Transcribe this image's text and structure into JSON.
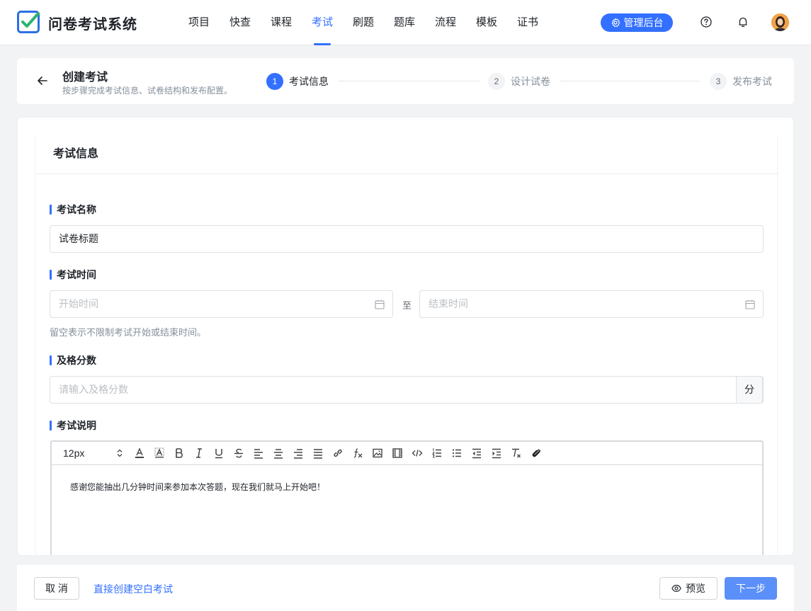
{
  "app": {
    "title": "问卷考试系统"
  },
  "nav": {
    "items": [
      {
        "label": "项目"
      },
      {
        "label": "快查"
      },
      {
        "label": "课程"
      },
      {
        "label": "考试",
        "active": true
      },
      {
        "label": "刷题"
      },
      {
        "label": "题库"
      },
      {
        "label": "流程"
      },
      {
        "label": "模板"
      },
      {
        "label": "证书"
      }
    ],
    "admin_label": "管理后台"
  },
  "header": {
    "title": "创建考试",
    "subtitle": "按步骤完成考试信息、试卷结构和发布配置。",
    "steps": [
      {
        "num": "1",
        "label": "考试信息"
      },
      {
        "num": "2",
        "label": "设计试卷"
      },
      {
        "num": "3",
        "label": "发布考试"
      }
    ]
  },
  "form": {
    "section_title": "考试信息",
    "name": {
      "label": "考试名称",
      "value": "试卷标题"
    },
    "time": {
      "label": "考试时间",
      "start_placeholder": "开始时间",
      "separator": "至",
      "end_placeholder": "结束时间",
      "hint": "留空表示不限制考试开始或结束时间。"
    },
    "pass_score": {
      "label": "及格分数",
      "placeholder": "请输入及格分数",
      "suffix": "分"
    },
    "description": {
      "label": "考试说明",
      "font_size": "12px",
      "content": "感谢您能抽出几分钟时间来参加本次答题，现在我们就马上开始吧！"
    }
  },
  "footer": {
    "cancel_label": "取 消",
    "blank_link": "直接创建空白考试",
    "preview_label": "预览",
    "next_label": "下一步"
  },
  "colors": {
    "primary": "#3370ff",
    "next_button": "#5b8ff9"
  }
}
